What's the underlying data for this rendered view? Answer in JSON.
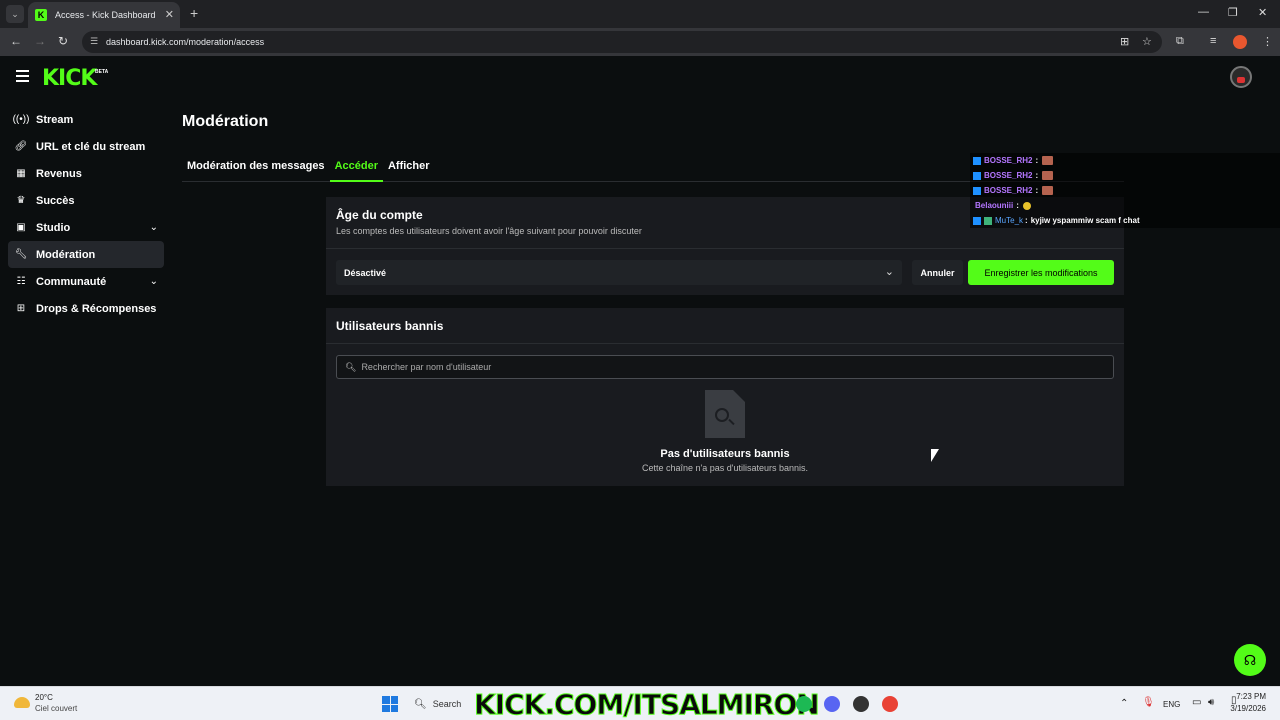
{
  "browser": {
    "tab_title": "Access - Kick Dashboard",
    "url": "dashboard.kick.com/moderation/access"
  },
  "header": {
    "logo": "KICK",
    "logo_badge": "BETA"
  },
  "sidebar": {
    "items": [
      {
        "label": "Stream",
        "icon": "broadcast-icon"
      },
      {
        "label": "URL et clé du stream",
        "icon": "link-icon"
      },
      {
        "label": "Revenus",
        "icon": "chart-icon"
      },
      {
        "label": "Succès",
        "icon": "trophy-icon"
      },
      {
        "label": "Studio",
        "icon": "studio-icon"
      },
      {
        "label": "Modération",
        "icon": "wrench-icon"
      },
      {
        "label": "Communauté",
        "icon": "community-icon"
      },
      {
        "label": "Drops & Récompenses",
        "icon": "drops-icon"
      }
    ]
  },
  "main": {
    "title": "Modération",
    "tabs": [
      {
        "label": "Modération des messages"
      },
      {
        "label": "Accéder"
      },
      {
        "label": "Afficher"
      }
    ],
    "account_age": {
      "title": "Âge du compte",
      "subtitle": "Les comptes des utilisateurs doivent avoir l'âge suivant pour pouvoir discuter",
      "selected": "Désactivé",
      "cancel_label": "Annuler",
      "save_label": "Enregistrer les modifications"
    },
    "banned": {
      "title": "Utilisateurs bannis",
      "search_placeholder": "Rechercher par nom d'utilisateur",
      "empty_title": "Pas d'utilisateurs bannis",
      "empty_sub": "Cette chaîne n'a pas d'utilisateurs bannis."
    }
  },
  "chat": [
    {
      "user": "BOSSE_RH2",
      "sep": ":",
      "msg": ""
    },
    {
      "user": "BOSSE_RH2",
      "sep": ":",
      "msg": ""
    },
    {
      "user": "BOSSE_RH2",
      "sep": ":",
      "msg": ""
    },
    {
      "user": "Belaouniii",
      "sep": ":",
      "msg": ""
    },
    {
      "user": "MuTe_k",
      "sep": ":",
      "msg": "kyjiw yspammiw scam f chat"
    }
  ],
  "taskbar": {
    "temp": "20°C",
    "weather": "Ciel couvert",
    "search_label": "Search",
    "banner": "KICK.COM/ITSALMIRON",
    "lang": "ENG",
    "time": "7:23 PM",
    "date": "3/19/2026"
  },
  "colors": {
    "accent": "#53fc18",
    "card": "#191b1f",
    "background": "#0b0e0f"
  }
}
